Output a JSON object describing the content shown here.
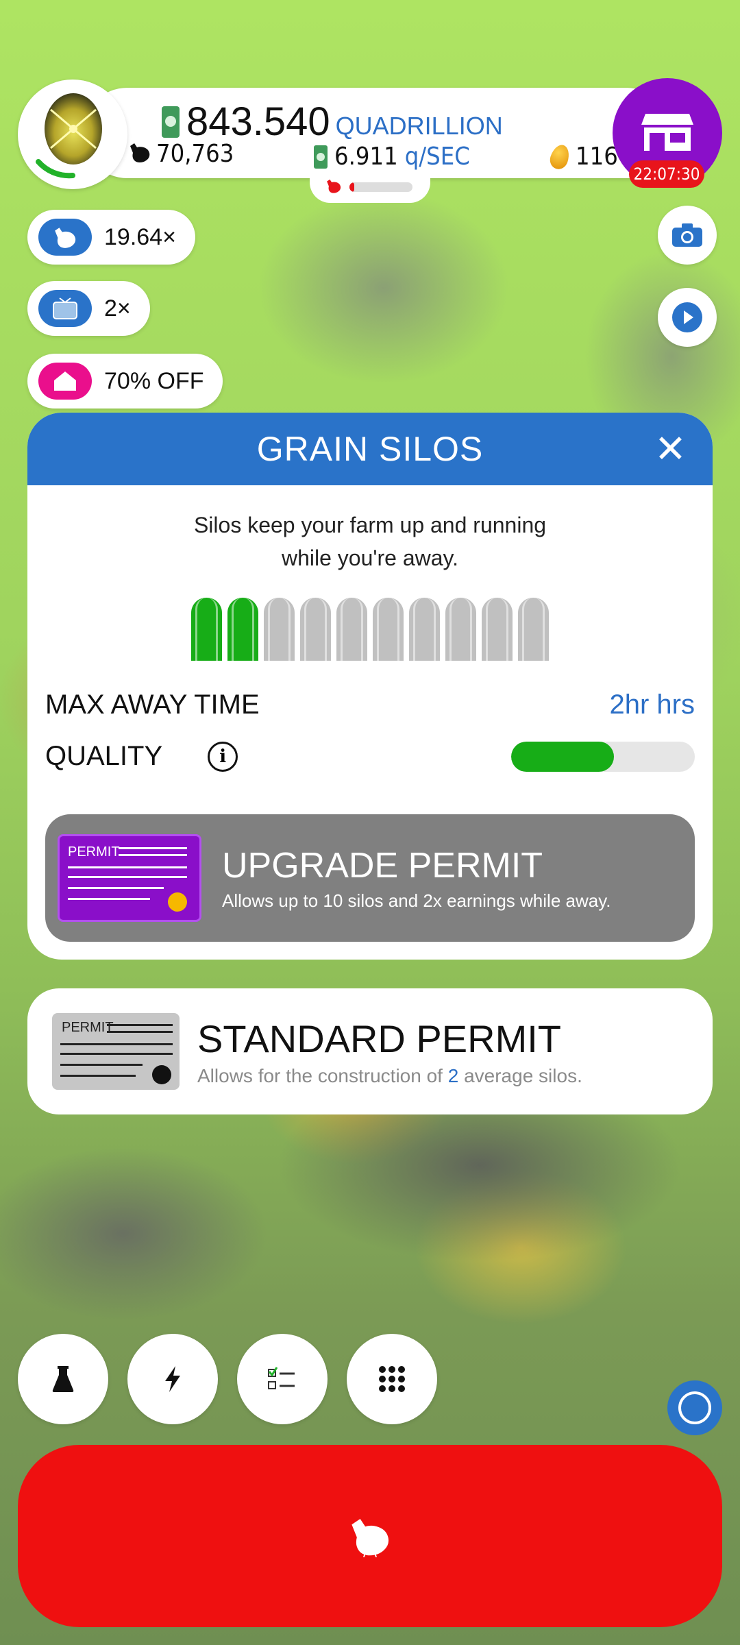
{
  "hud": {
    "money_amount": "843.540",
    "money_unit": "QUADRILLION",
    "chickens": "70,763",
    "rate_value": "6.911",
    "rate_unit": "q/SEC",
    "golden_eggs": "116",
    "shop_timer": "22:07:30",
    "hab_progress": 0.08
  },
  "boosts": {
    "chicken_multiplier": "19.64×",
    "video_multiplier": "2×",
    "hab_sale": "70% OFF"
  },
  "silos_panel": {
    "title": "GRAIN SILOS",
    "description": "Silos keep your farm up and running while you're away.",
    "silos_owned": 2,
    "silos_total": 10,
    "max_away_label": "MAX AWAY TIME",
    "max_away_value": "2hr hrs",
    "quality_label": "QUALITY",
    "quality_level": 0.56,
    "upgrade": {
      "card_word": "PERMIT",
      "title": "UPGRADE PERMIT",
      "subtitle": "Allows up to 10 silos and 2x earnings while away."
    }
  },
  "standard_permit": {
    "card_word": "PERMIT",
    "title": "STANDARD PERMIT",
    "subtitle_pre": "Allows for the construction of ",
    "subtitle_num": "2",
    "subtitle_post": " average silos."
  },
  "icons": [
    "egg-icon",
    "shop-icon",
    "chicken-icon",
    "cash-icon",
    "golden-egg-icon",
    "tv-icon",
    "house-icon",
    "camera-icon",
    "play-icon",
    "close-icon",
    "info-icon",
    "flask-icon",
    "lightning-icon",
    "checklist-icon",
    "grid-icon",
    "circle-icon"
  ],
  "colors": {
    "accent_blue": "#2a73c9",
    "shop_purple": "#8a0fc9",
    "hatch_red": "#ef1010",
    "silo_filled": "#17ad17",
    "silo_empty": "#c0c0c0"
  }
}
